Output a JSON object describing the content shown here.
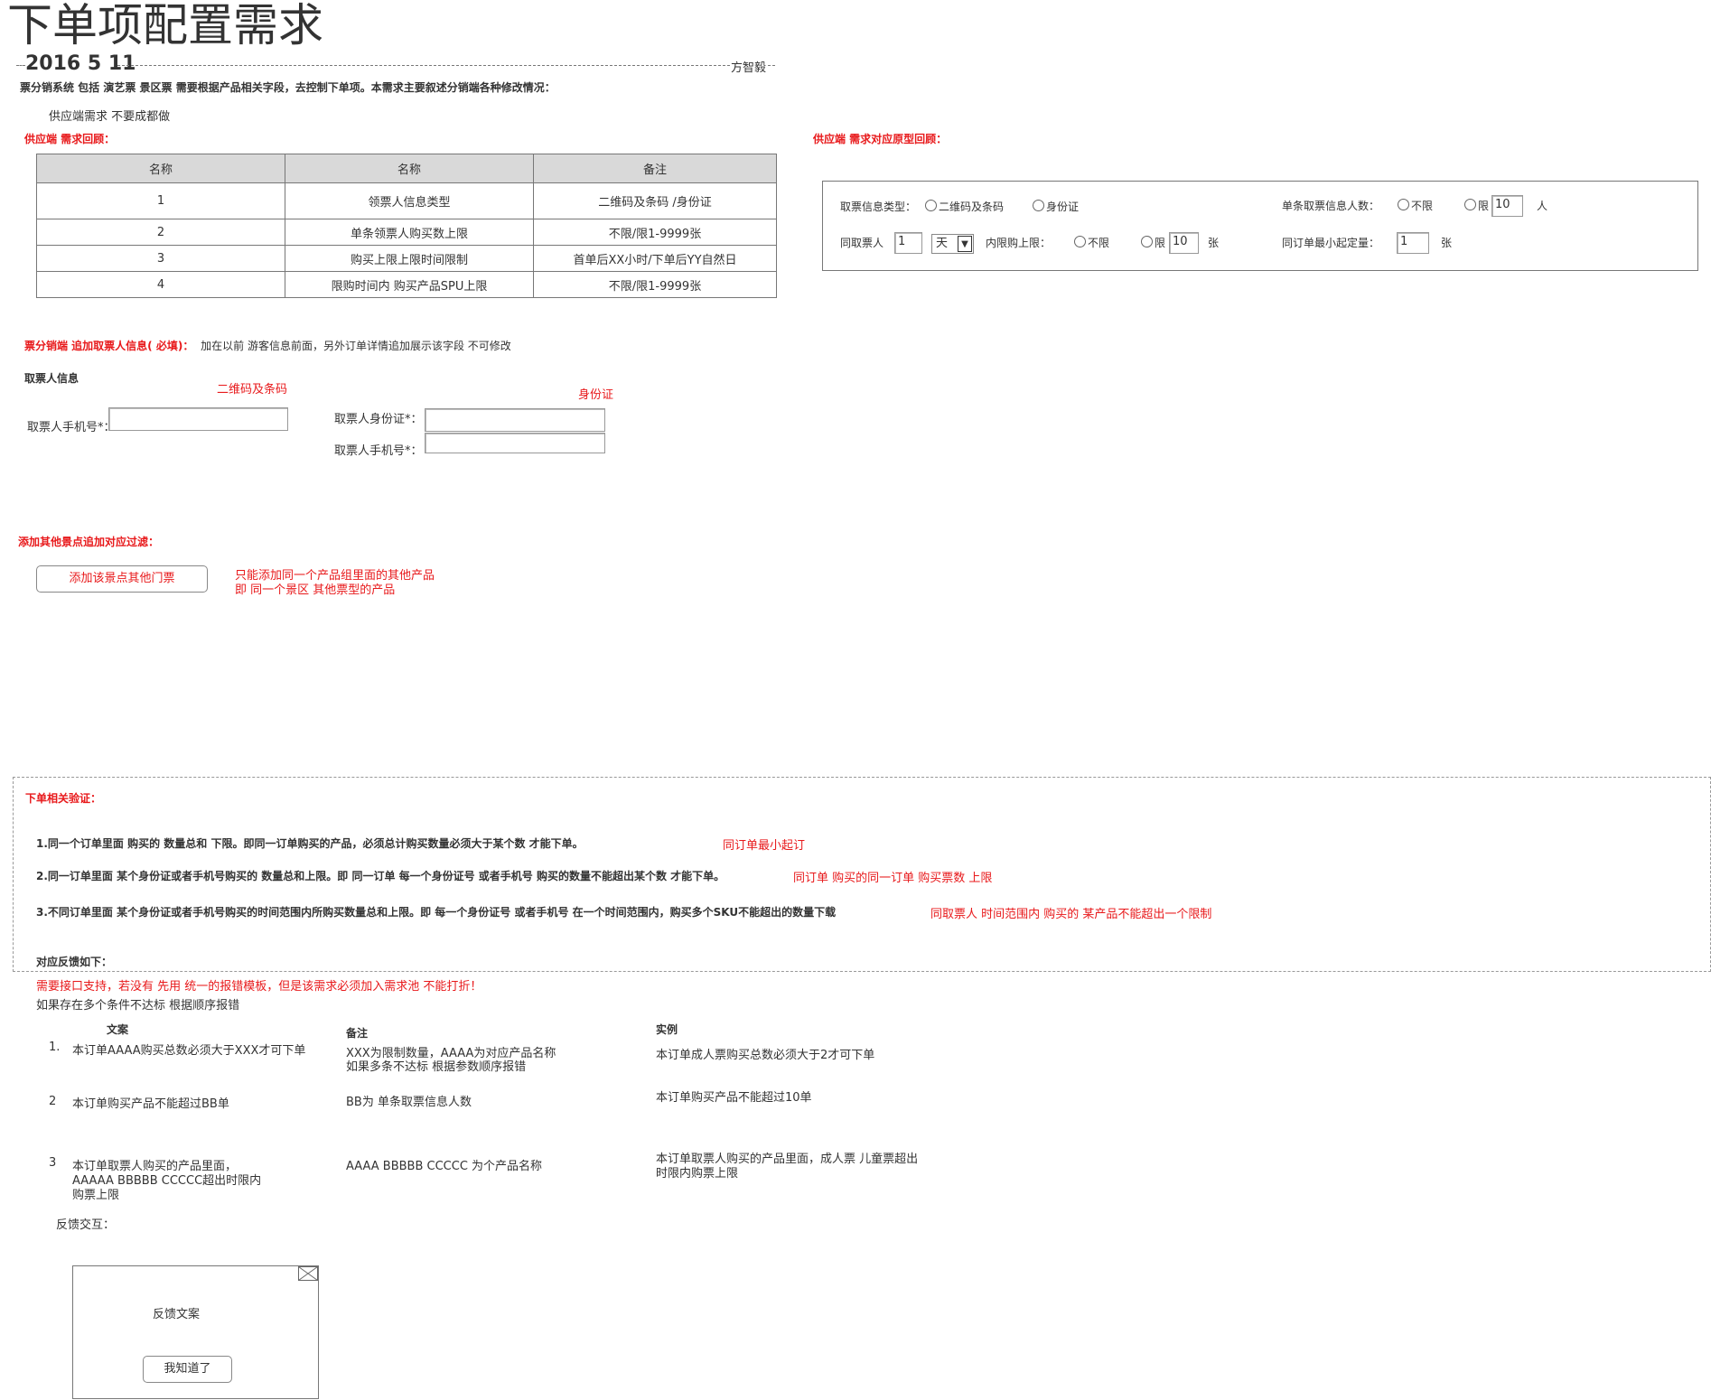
{
  "header": {
    "title": "下单项配置需求",
    "date": "2016 5 11",
    "author": "方智毅",
    "intro": "票分销系统 包括  演艺票  景区票 需要根据产品相关字段，去控制下单项。本需求主要叙述分销端各种修改情况：",
    "supply_note": "供应端需求 不要成都做"
  },
  "supply_review": {
    "heading": "供应端 需求回顾：",
    "columns": [
      "名称",
      "名称",
      "备注"
    ],
    "rows": [
      [
        "1",
        "领票人信息类型",
        "二维码及条码 /身份证"
      ],
      [
        "2",
        "单条领票人购买数上限",
        "不限/限1-9999张"
      ],
      [
        "3",
        "购买上限上限时间限制",
        "首单后XX小时/下单后YY自然日"
      ],
      [
        "4",
        "限购时间内 购买产品SPU上限",
        "不限/限1-9999张"
      ]
    ]
  },
  "prototype": {
    "heading": "供应端 需求对应原型回顾：",
    "ticket_type_label": "取票信息类型：",
    "opt_qrcode": "二维码及条码",
    "opt_idcard": "身份证",
    "per_count_label": "单条取票信息人数：",
    "opt_unlimited": "不限",
    "opt_limit": "限",
    "per_count_value": "10",
    "per_count_unit": "人",
    "same_person_label": "同取票人",
    "same_person_value": "1",
    "period_value": "天",
    "inner_limit_label": "内限购上限：",
    "opt_unlimited2": "不限",
    "opt_limit2": "限",
    "inner_limit_value": "10",
    "inner_limit_unit": "张",
    "min_order_label": "同订单最小起定量：",
    "min_order_value": "1",
    "min_order_unit": "张"
  },
  "distributor": {
    "heading": "票分销端 追加取票人信息( 必填)：",
    "note": "加在以前 游客信息前面，另外订单详情追加展示该字段 不可修改",
    "section_label": "取票人信息",
    "qr_label": "二维码及条码",
    "id_label": "身份证",
    "phone_field_label": "取票人手机号*：",
    "id_field_label": "取票人身份证*：",
    "phone_field_label2": "取票人手机号*："
  },
  "other_spots": {
    "heading": "添加其他景点追加对应过滤：",
    "button": "添加该景点其他门票",
    "note_line1": "只能添加同一个产品组里面的其他产品",
    "note_line2": "即 同一个景区 其他票型的产品"
  },
  "validation": {
    "heading": "下单相关验证：",
    "items": [
      {
        "text": "1.同一个订单里面 购买的 数量总和 下限。即同一订单购买的产品，必须总计购买数量必须大于某个数 才能下单。",
        "note": "同订单最小起订"
      },
      {
        "text": "2.同一订单里面 某个身份证或者手机号购买的 数量总和上限。即 同一订单 每一个身份证号 或者手机号 购买的数量不能超出某个数 才能下单。",
        "note": "同订单 购买的同一订单 购买票数 上限"
      },
      {
        "text": "3.不同订单里面 某个身份证或者手机号购买的时间范围内所购买数量总和上限。即 每一个身份证号 或者手机号 在一个时间范围内，购买多个SKU不能超出的数量下载",
        "note": "同取票人 时间范围内 购买的 某产品不能超出一个限制"
      }
    ],
    "feedback_heading": "对应反馈如下：",
    "interface_note": "需要接口支持，若没有 先用 统一的报错模板，但是该需求必须加入需求池 不能打折！",
    "multi_note": "如果存在多个条件不达标 根据顺序报错"
  },
  "copy_table": {
    "col_text": "文案",
    "col_remark": "备注",
    "col_example": "实例",
    "rows": [
      {
        "num": "1.",
        "text": "本订单AAAA购买总数必须大于XXX才可下单",
        "remark1": "XXX为限制数量，AAAA为对应产品名称",
        "remark2": "如果多条不达标 根据参数顺序报错",
        "example1": "本订单成人票购买总数必须大于2才可下单",
        "example2": ""
      },
      {
        "num": "2",
        "text": "本订单购买产品不能超过BB单",
        "remark1": "BB为 单条取票信息人数",
        "remark2": "",
        "example1": "本订单购买产品不能超过10单",
        "example2": ""
      },
      {
        "num": "3",
        "text": "本订单取票人购买的产品里面，",
        "text2": "AAAAA BBBBB CCCCC超出时限内",
        "text3": "购票上限",
        "remark1": "AAAA BBBBB CCCCC 为个产品名称",
        "remark2": "",
        "example1": "本订单取票人购买的产品里面，成人票 儿童票超出",
        "example2": "时限内购票上限"
      }
    ]
  },
  "feedback_dialog": {
    "label": "反馈交互：",
    "content": "反馈文案",
    "button": "我知道了",
    "close_icon": "close-icon"
  }
}
